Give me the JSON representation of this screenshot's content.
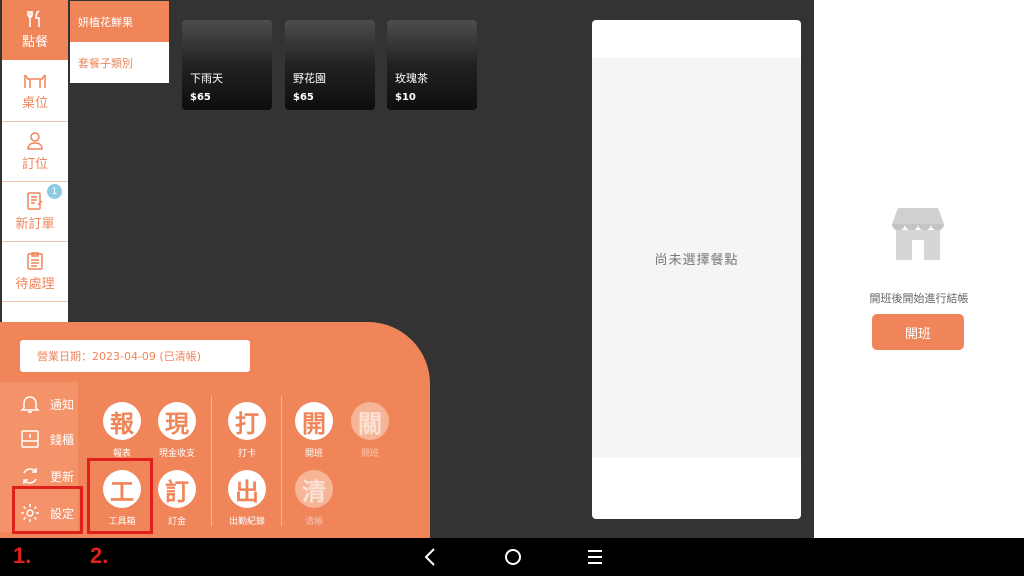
{
  "nav": {
    "items": [
      {
        "label": "點餐",
        "icon": "utensils-icon",
        "active": true
      },
      {
        "label": "桌位",
        "icon": "table-icon"
      },
      {
        "label": "訂位",
        "icon": "person-icon"
      },
      {
        "label": "新訂單",
        "icon": "order-icon",
        "badge": "1"
      },
      {
        "label": "待處理",
        "icon": "clipboard-icon"
      }
    ]
  },
  "categories": [
    {
      "label": "妍植花鮮果",
      "active": true
    },
    {
      "label": "套餐子類別",
      "active": false
    }
  ],
  "products": [
    {
      "name": "下雨天",
      "price": "$65"
    },
    {
      "name": "野花園",
      "price": "$65"
    },
    {
      "name": "玫瑰茶",
      "price": "$10"
    }
  ],
  "order": {
    "empty_text": "尚未選擇餐點"
  },
  "shift": {
    "message": "開班後開始進行結帳",
    "button": "開班"
  },
  "drawer": {
    "date_label": "營業日期：2023-04-09 (已清帳)",
    "side_items": [
      {
        "label": "通知",
        "icon": "bell-icon"
      },
      {
        "label": "錢櫃",
        "icon": "cash-drawer-icon"
      },
      {
        "label": "更新",
        "icon": "refresh-icon"
      },
      {
        "label": "設定",
        "icon": "gear-icon"
      }
    ],
    "tools": [
      {
        "glyph": "報",
        "label": "報表"
      },
      {
        "glyph": "現",
        "label": "現金收支"
      },
      {
        "glyph": "打",
        "label": "打卡"
      },
      {
        "glyph": "開",
        "label": "開班"
      },
      {
        "glyph": "關",
        "label": "關班"
      },
      {
        "glyph": "工",
        "label": "工具箱"
      },
      {
        "glyph": "訂",
        "label": "訂金"
      },
      {
        "glyph": "出",
        "label": "出勤紀錄"
      },
      {
        "glyph": "清",
        "label": "清帳"
      }
    ]
  },
  "annotations": {
    "step1": "1.",
    "step2": "2."
  },
  "colors": {
    "accent": "#f0855a",
    "background": "#333333",
    "highlight": "#e0201b"
  }
}
